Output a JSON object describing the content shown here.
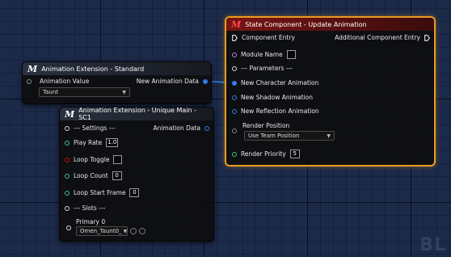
{
  "node_standard": {
    "title": "Animation Extension - Standard",
    "animation_value_label": "Animation Value",
    "animation_value_select": "Taunt",
    "new_animation_data_label": "New Animation Data"
  },
  "node_unique": {
    "title": "Animation Extension - Unique Main - SC1",
    "settings_label": "--- Settings ---",
    "animation_data_label": "Animation Data",
    "play_rate_label": "Play Rate",
    "play_rate_value": "1.0",
    "loop_toggle_label": "Loop Toggle",
    "loop_count_label": "Loop Count",
    "loop_count_value": "0",
    "loop_start_frame_label": "Loop Start Frame",
    "loop_start_frame_value": "0",
    "slots_label": "--- Slots ---",
    "primary_label": "Primary 0",
    "primary_select": "Omen_Taunt0_"
  },
  "node_state": {
    "title": "State Component - Update Animation",
    "component_entry_label": "Component Entry",
    "additional_component_entry_label": "Additional Component Entry",
    "module_name_label": "Module Name",
    "parameters_label": "--- Parameters ---",
    "new_character_animation_label": "New Character Animation",
    "new_shadow_animation_label": "New Shadow Animation",
    "new_reflection_animation_label": "New Reflection Animation",
    "render_position_label": "Render Position",
    "render_position_select": "Use Team Position",
    "render_priority_label": "Render Priority",
    "render_priority_value": "5"
  },
  "watermark": "BL",
  "colors": {
    "selection_outline": "#e89b1e",
    "pin_float": "#3ec77a",
    "pin_bool": "#b61c1c",
    "pin_struct": "#2f7fe6",
    "pin_string": "#c07ae6"
  },
  "icons": [
    "exec-pin-icon",
    "data-pin-icon",
    "chevron-down-icon",
    "reset-icon",
    "search-icon",
    "m-logo-icon"
  ]
}
